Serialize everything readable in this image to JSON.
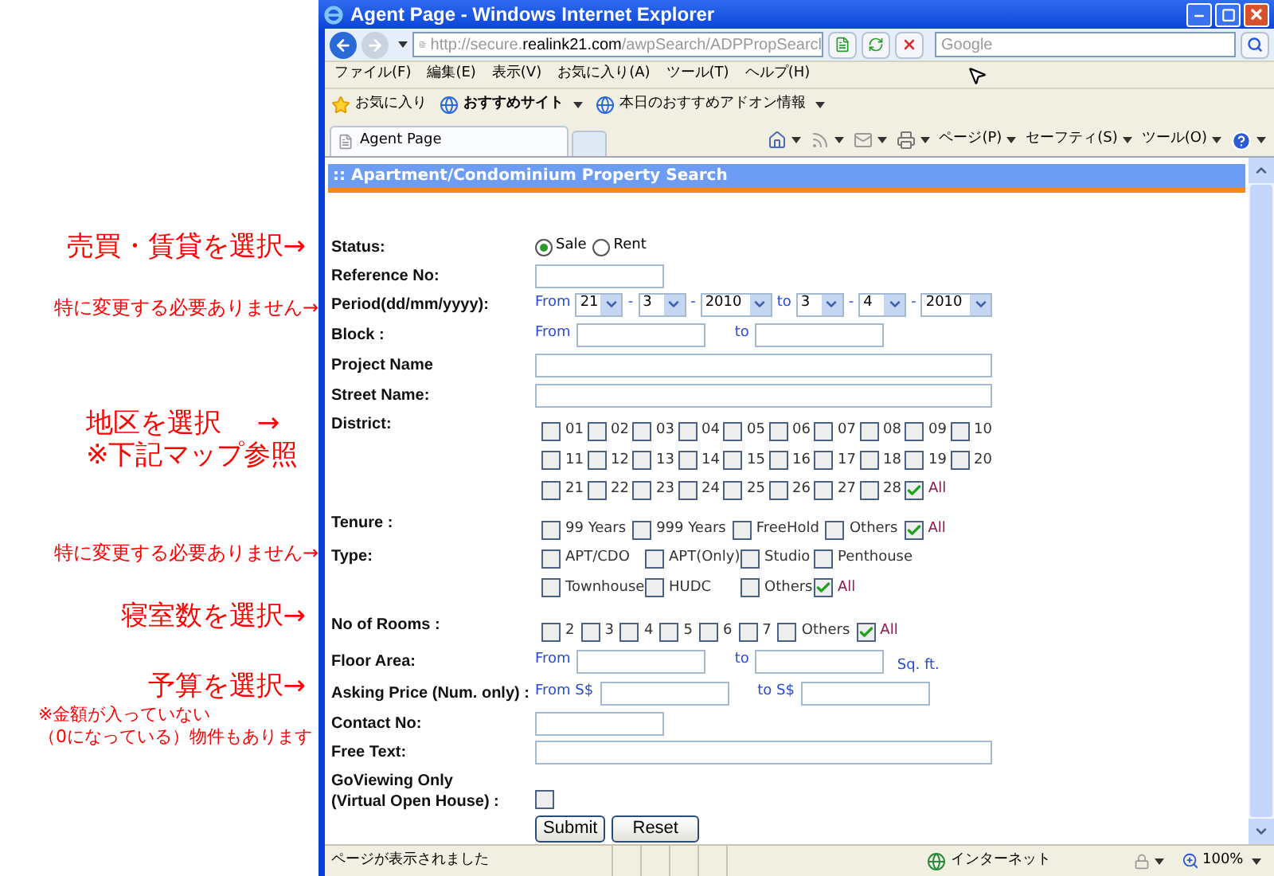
{
  "annotations": [
    {
      "kind": "heading",
      "lines": [
        "売買・賃貸を選択→"
      ]
    },
    {
      "kind": "hint",
      "lines": [
        "特に変更する必要ありません→"
      ]
    },
    {
      "kind": "block",
      "lines": [
        "地区を選択　 →",
        "※下記マップ参照"
      ]
    },
    {
      "kind": "hint",
      "lines": [
        "特に変更する必要ありません→"
      ]
    },
    {
      "kind": "heading",
      "lines": [
        "寝室数を選択→"
      ]
    },
    {
      "kind": "heading",
      "lines": [
        "予算を選択→"
      ]
    },
    {
      "kind": "note",
      "lines": [
        "※金額が入っていない",
        "（0になっている）物件もあります"
      ]
    }
  ],
  "browser": {
    "title": "Agent Page - Windows Internet Explorer",
    "address": {
      "prefix": "http://secure.",
      "domain": "realink21.com",
      "path": "/awpSearch/ADPPropSearcl"
    },
    "search_placeholder": "Google",
    "menu": [
      "ファイル(F)",
      "編集(E)",
      "表示(V)",
      "お気に入り(A)",
      "ツール(T)",
      "ヘルプ(H)"
    ],
    "favorites": [
      {
        "kind": "favorites",
        "label": "お気に入り"
      },
      {
        "kind": "site",
        "label": "おすすめサイト"
      },
      {
        "kind": "page",
        "label": "本日のおすすめアドオン情報"
      }
    ],
    "tab": "Agent Page",
    "commands": [
      "ページ(P)",
      "セーフティ(S)",
      "ツール(O)"
    ],
    "status_text": "ページが表示されました",
    "zone": "インターネット",
    "zoom": "100%"
  },
  "form": {
    "title": ":: Apartment/Condominium Property Search",
    "fields": [
      {
        "kind": "radio",
        "label": [
          "Status:"
        ],
        "options": [
          {
            "label": "Sale",
            "selected": true
          },
          {
            "label": "Rent",
            "selected": false
          }
        ]
      },
      {
        "kind": "short_text",
        "label": [
          "Reference No:"
        ]
      },
      {
        "kind": "period",
        "label": [
          "Period(dd/mm/yyyy):"
        ],
        "from_label": "From",
        "from": [
          "21",
          "3",
          "2010"
        ],
        "to_label": "to",
        "to": [
          "3",
          "4",
          "2010"
        ],
        "separator": "-"
      },
      {
        "kind": "range",
        "label": [
          "Block :"
        ],
        "from_label": "From",
        "to_label": "to"
      },
      {
        "kind": "long_text",
        "label": [
          "Project Name"
        ]
      },
      {
        "kind": "long_text",
        "label": [
          "Street Name:"
        ]
      },
      {
        "kind": "district_checks",
        "label": [
          "District:"
        ],
        "options": [
          {
            "label": "01",
            "checked": false
          },
          {
            "label": "02",
            "checked": false
          },
          {
            "label": "03",
            "checked": false
          },
          {
            "label": "04",
            "checked": false
          },
          {
            "label": "05",
            "checked": false
          },
          {
            "label": "06",
            "checked": false
          },
          {
            "label": "07",
            "checked": false
          },
          {
            "label": "08",
            "checked": false
          },
          {
            "label": "09",
            "checked": false
          },
          {
            "label": "10",
            "checked": false
          },
          {
            "label": "11",
            "checked": false
          },
          {
            "label": "12",
            "checked": false
          },
          {
            "label": "13",
            "checked": false
          },
          {
            "label": "14",
            "checked": false
          },
          {
            "label": "15",
            "checked": false
          },
          {
            "label": "16",
            "checked": false
          },
          {
            "label": "17",
            "checked": false
          },
          {
            "label": "18",
            "checked": false
          },
          {
            "label": "19",
            "checked": false
          },
          {
            "label": "20",
            "checked": false
          },
          {
            "label": "21",
            "checked": false
          },
          {
            "label": "22",
            "checked": false
          },
          {
            "label": "23",
            "checked": false
          },
          {
            "label": "24",
            "checked": false
          },
          {
            "label": "25",
            "checked": false
          },
          {
            "label": "26",
            "checked": false
          },
          {
            "label": "27",
            "checked": false
          },
          {
            "label": "28",
            "checked": false
          },
          {
            "label": "All",
            "checked": true
          }
        ]
      },
      {
        "kind": "checks",
        "label": [
          "Tenure :"
        ],
        "options": [
          {
            "label": "99 Years",
            "checked": false
          },
          {
            "label": "999 Years",
            "checked": false
          },
          {
            "label": "FreeHold",
            "checked": false
          },
          {
            "label": "Others",
            "checked": false
          },
          {
            "label": "All",
            "checked": true
          }
        ]
      },
      {
        "kind": "type_checks",
        "label": [
          "Type:"
        ],
        "options": [
          {
            "label": "APT/CDO",
            "checked": false
          },
          {
            "label": "APT(Only)",
            "checked": false
          },
          {
            "label": "Studio",
            "checked": false
          },
          {
            "label": "Penthouse",
            "checked": false
          },
          {
            "label": "Townhouse",
            "checked": false
          },
          {
            "label": "HUDC",
            "checked": false
          },
          {
            "label": "Others",
            "checked": false
          },
          {
            "label": "All",
            "checked": true
          }
        ]
      },
      {
        "kind": "checks",
        "label": [
          "No of Rooms :"
        ],
        "options": [
          {
            "label": "2",
            "checked": false
          },
          {
            "label": "3",
            "checked": false
          },
          {
            "label": "4",
            "checked": false
          },
          {
            "label": "5",
            "checked": false
          },
          {
            "label": "6",
            "checked": false
          },
          {
            "label": "7",
            "checked": false
          },
          {
            "label": "Others",
            "checked": false
          },
          {
            "label": "All",
            "checked": true
          }
        ]
      },
      {
        "kind": "range",
        "label": [
          "Floor Area:"
        ],
        "from_label": "From",
        "to_label": "to",
        "unit": "Sq. ft."
      },
      {
        "kind": "range",
        "label": [
          "Asking Price (Num. only) :"
        ],
        "from_label": "From S$",
        "to_label": "to S$"
      },
      {
        "kind": "short_text",
        "label": [
          "Contact No:"
        ]
      },
      {
        "kind": "long_text",
        "label": [
          "Free Text:"
        ]
      },
      {
        "kind": "checkbox",
        "label": [
          "GoViewing Only",
          "(Virtual Open House) :"
        ],
        "checked": false
      }
    ],
    "buttons": [
      "Submit",
      "Reset"
    ]
  }
}
